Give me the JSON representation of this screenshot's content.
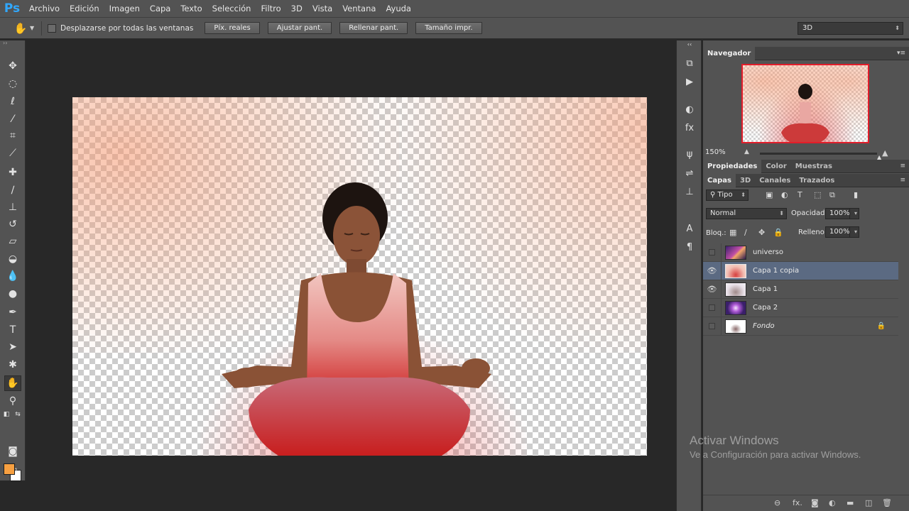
{
  "app": {
    "logo": "Ps"
  },
  "menu": [
    "Archivo",
    "Edición",
    "Imagen",
    "Capa",
    "Texto",
    "Selección",
    "Filtro",
    "3D",
    "Vista",
    "Ventana",
    "Ayuda"
  ],
  "options": {
    "scroll_all_label": "Desplazarse por todas las ventanas",
    "scroll_all_checked": false,
    "buttons": [
      "Píx. reales",
      "Ajustar pant.",
      "Rellenar pant.",
      "Tamaño impr."
    ],
    "workspace": "3D"
  },
  "tools": [
    "move-icon",
    "marquee-icon",
    "lasso-icon",
    "quick-select-icon",
    "crop-icon",
    "eyedropper-icon",
    "healing-brush-icon",
    "brush-icon",
    "clone-stamp-icon",
    "history-brush-icon",
    "eraser-icon",
    "paint-bucket-icon",
    "blur-icon",
    "dodge-icon",
    "pen-icon",
    "type-icon",
    "path-select-icon",
    "custom-shape-icon",
    "hand-icon",
    "zoom-icon"
  ],
  "colors": {
    "foreground": "#f7a041",
    "background": "#ffffff"
  },
  "navigator": {
    "title": "Navegador",
    "zoom": "150%"
  },
  "properties_tabs": [
    "Propiedades",
    "Color",
    "Muestras"
  ],
  "layers_tabs": [
    "Capas",
    "3D",
    "Canales",
    "Trazados"
  ],
  "layers": {
    "filter": "Tipo",
    "blend_mode": "Normal",
    "opacity_label": "Opacidad:",
    "opacity": "100%",
    "lock_label": "Bloq.:",
    "fill_label": "Relleno:",
    "fill": "100%",
    "items": [
      {
        "name": "universo",
        "visible": false,
        "selected": false
      },
      {
        "name": "Capa 1 copia",
        "visible": true,
        "selected": true
      },
      {
        "name": "Capa 1",
        "visible": true,
        "selected": false
      },
      {
        "name": "Capa 2",
        "visible": false,
        "selected": false
      },
      {
        "name": "Fondo",
        "visible": false,
        "selected": false,
        "locked": true
      }
    ]
  },
  "watermark": {
    "line1": "Activar Windows",
    "line2": "Ve a Configuración para activar Windows."
  }
}
